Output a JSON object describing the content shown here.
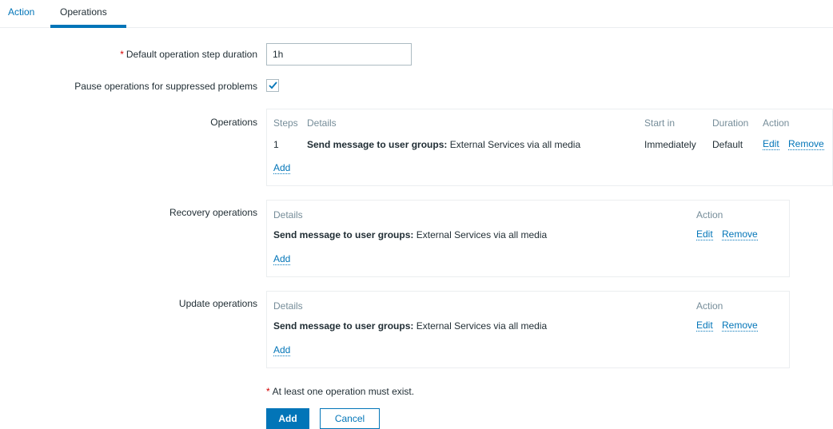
{
  "tabs": {
    "action": "Action",
    "operations": "Operations"
  },
  "form": {
    "step_duration": {
      "label": "Default operation step duration",
      "value": "1h"
    },
    "pause_suppressed": {
      "label": "Pause operations for suppressed problems",
      "checked": true
    }
  },
  "operations": {
    "label": "Operations",
    "headers": {
      "steps": "Steps",
      "details": "Details",
      "start_in": "Start in",
      "duration": "Duration",
      "action": "Action"
    },
    "row": {
      "step": "1",
      "details_bold": "Send message to user groups:",
      "details_rest": " External Services via all media",
      "start_in": "Immediately",
      "duration": "Default",
      "edit": "Edit",
      "remove": "Remove"
    },
    "add": "Add"
  },
  "recovery": {
    "label": "Recovery operations",
    "headers": {
      "details": "Details",
      "action": "Action"
    },
    "row": {
      "details_bold": "Send message to user groups:",
      "details_rest": " External Services via all media",
      "edit": "Edit",
      "remove": "Remove"
    },
    "add": "Add"
  },
  "update": {
    "label": "Update operations",
    "headers": {
      "details": "Details",
      "action": "Action"
    },
    "row": {
      "details_bold": "Send message to user groups:",
      "details_rest": " External Services via all media",
      "edit": "Edit",
      "remove": "Remove"
    },
    "add": "Add"
  },
  "hint": "At least one operation must exist.",
  "buttons": {
    "add": "Add",
    "cancel": "Cancel"
  },
  "colors": {
    "accent": "#0275b8",
    "required": "#d40000",
    "muted": "#768d99",
    "text": "#1f2c33"
  }
}
